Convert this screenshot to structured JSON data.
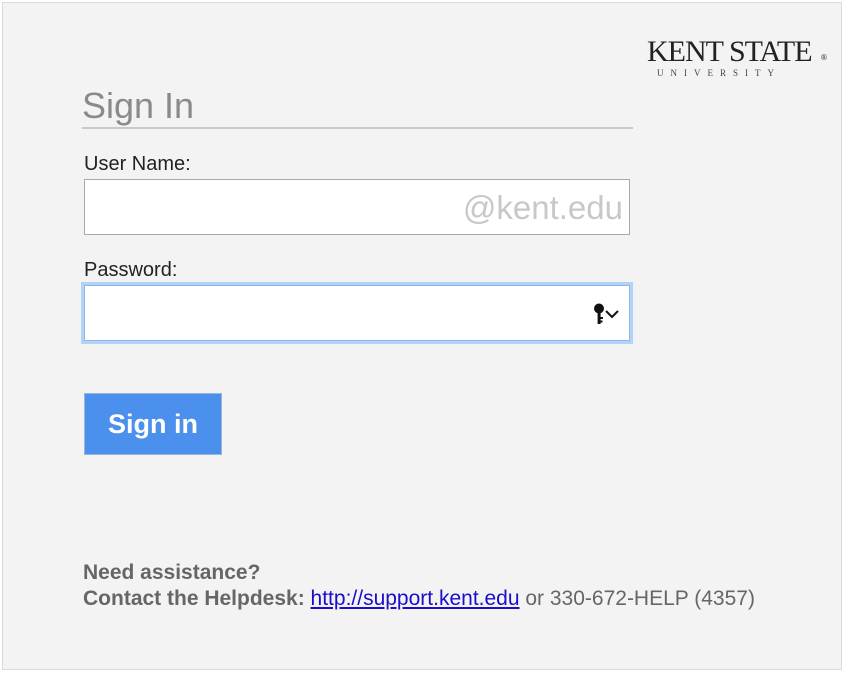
{
  "logo": {
    "main": "KENT STATE",
    "sub": "UNIVERSITY",
    "reg": "®"
  },
  "signin": {
    "title": "Sign In",
    "username_label": "User Name:",
    "username_value": "",
    "username_suffix": "@kent.edu",
    "password_label": "Password:",
    "password_value": "",
    "button_label": "Sign in"
  },
  "help": {
    "question": "Need assistance?",
    "contact_label": "Contact the Helpdesk:",
    "link_text": "http://support.kent.edu",
    "phone_text": " or 330-672-HELP (4357)"
  },
  "colors": {
    "panel_bg": "#f3f3f3",
    "button_bg": "#4a90ec",
    "focus_ring": "#b4d2f5",
    "link": "#1a0dcc"
  },
  "icons": [
    "keychain-key-icon",
    "chevron-down-icon"
  ]
}
